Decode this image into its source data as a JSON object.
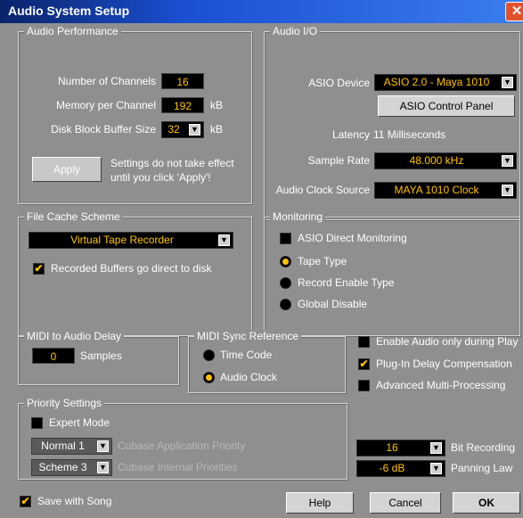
{
  "window": {
    "title": "Audio System Setup",
    "close_glyph": "✕"
  },
  "audio_performance": {
    "legend": "Audio Performance",
    "channels_label": "Number of Channels",
    "channels_value": "16",
    "memory_label": "Memory per Channel",
    "memory_value": "192",
    "memory_unit": "kB",
    "disk_label": "Disk Block Buffer Size",
    "disk_value": "32",
    "disk_unit": "kB",
    "apply_label": "Apply",
    "apply_note_1": "Settings do not take effect",
    "apply_note_2": "until you click 'Apply'!"
  },
  "audio_io": {
    "legend": "Audio I/O",
    "asio_device_label": "ASIO Device",
    "asio_device_value": "ASIO 2.0 - Maya 1010",
    "control_panel_label": "ASIO Control Panel",
    "latency_label": "Latency",
    "latency_value": "11 Milliseconds",
    "sample_rate_label": "Sample Rate",
    "sample_rate_value": "48.000 kHz",
    "clock_source_label": "Audio Clock Source",
    "clock_source_value": "MAYA 1010 Clock"
  },
  "file_cache": {
    "legend": "File Cache Scheme",
    "scheme_value": "Virtual Tape Recorder",
    "recorded_buffers_label": "Recorded Buffers go direct to disk",
    "recorded_buffers_checked": true
  },
  "monitoring": {
    "legend": "Monitoring",
    "asio_direct_label": "ASIO Direct Monitoring",
    "asio_direct_checked": false,
    "options": [
      {
        "label": "Tape Type",
        "selected": true
      },
      {
        "label": "Record Enable Type",
        "selected": false
      },
      {
        "label": "Global Disable",
        "selected": false
      }
    ]
  },
  "midi_audio_delay": {
    "legend": "MIDI to Audio Delay",
    "value": "0",
    "unit": "Samples"
  },
  "midi_sync": {
    "legend": "MIDI Sync Reference",
    "options": [
      {
        "label": "Time Code",
        "selected": false
      },
      {
        "label": "Audio Clock",
        "selected": true
      }
    ]
  },
  "options": {
    "enable_audio_label": "Enable Audio only during Play",
    "enable_audio_checked": false,
    "plugin_delay_label": "Plug-In Delay Compensation",
    "plugin_delay_checked": true,
    "advanced_mp_label": "Advanced Multi-Processing",
    "advanced_mp_checked": false
  },
  "priority": {
    "legend": "Priority Settings",
    "expert_label": "Expert Mode",
    "expert_checked": false,
    "app_priority_value": "Normal 1",
    "app_priority_label": "Cubase Application Priority",
    "internal_priority_value": "Scheme 3",
    "internal_priority_label": "Cubase Internal Priorities"
  },
  "recording": {
    "bit_value": "16",
    "bit_label": "Bit Recording",
    "panning_value": "-6 dB",
    "panning_label": "Panning Law"
  },
  "footer": {
    "save_with_song_label": "Save with Song",
    "save_with_song_checked": true,
    "help_label": "Help",
    "cancel_label": "Cancel",
    "ok_label": "OK"
  },
  "check_glyph": "✔",
  "arrow_glyph": "▼"
}
